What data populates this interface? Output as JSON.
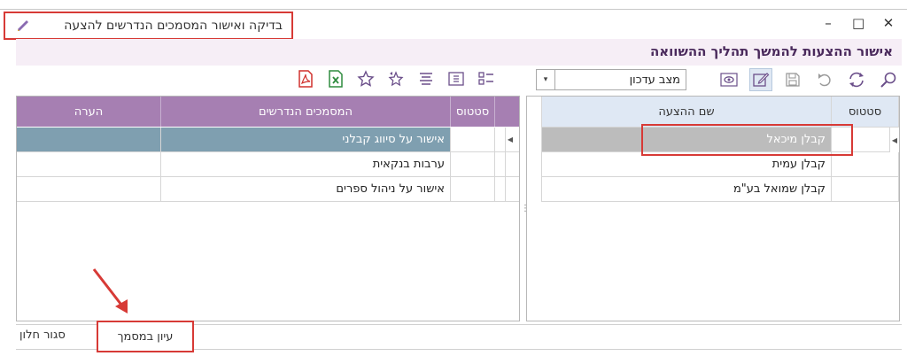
{
  "window": {
    "title": "בדיקה ואישור המסמכים הנדרשים להצעה",
    "controls": [
      "–",
      "□",
      "✕"
    ]
  },
  "header": {
    "text": "אישור ההצעות להמשך תהליך ההשוואה"
  },
  "toolbar": {
    "status_label": "מצב עדכון",
    "left_icons": [
      "pdf-icon",
      "excel-icon",
      "star-icon",
      "undo-star-icon",
      "align-icon",
      "expand-icon",
      "list-icon"
    ],
    "right_icons": [
      "search-icon",
      "refresh-icon",
      "undo-icon",
      "save-icon",
      "edit-icon",
      "view-icon"
    ]
  },
  "documents_table": {
    "columns": [
      "סטטוס",
      "המסמכים הנדרשים",
      "הערה"
    ],
    "rows": [
      {
        "status": "",
        "document": "אישור על סיווג קבלני",
        "note": ""
      },
      {
        "status": "",
        "document": "ערבות בנקאית",
        "note": ""
      },
      {
        "status": "",
        "document": "אישור על ניהול ספרים",
        "note": ""
      }
    ]
  },
  "offers_table": {
    "columns": [
      "סטטוס",
      "שם ההצעה"
    ],
    "rows": [
      {
        "status": "",
        "name": "קבלן מיכאל"
      },
      {
        "status": "",
        "name": "קבלן עמית"
      },
      {
        "status": "",
        "name": "קבלן שמואל בע\"מ"
      }
    ]
  },
  "footer": {
    "close_label": "סגור חלון",
    "view_doc_label": "עיון במסמך"
  },
  "colors": {
    "accent": "#a67fb2",
    "selection": "#7f9fb0",
    "highlight": "#d73a36",
    "header_band": "#f6eef6"
  }
}
